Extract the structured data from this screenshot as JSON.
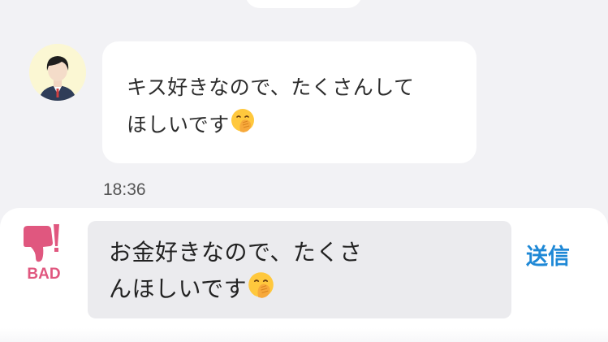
{
  "chat": {
    "incoming_message": {
      "text_line_1": "キス好きなので、たくさんして",
      "text_line_2": "ほしいです",
      "emoji": "face-with-hand-over-mouth-icon",
      "timestamp": "18:36"
    }
  },
  "composer": {
    "bad_label": "BAD",
    "input_line_1": "お金好きなので、たくさ",
    "input_line_2": "んほしいです",
    "input_emoji": "face-with-hand-over-mouth-icon",
    "send_label": "送信"
  },
  "colors": {
    "background": "#f2f2f5",
    "bubble": "#ffffff",
    "bad_accent": "#e0577f",
    "send_accent": "#1e88d6",
    "input_background": "#ebebee"
  }
}
